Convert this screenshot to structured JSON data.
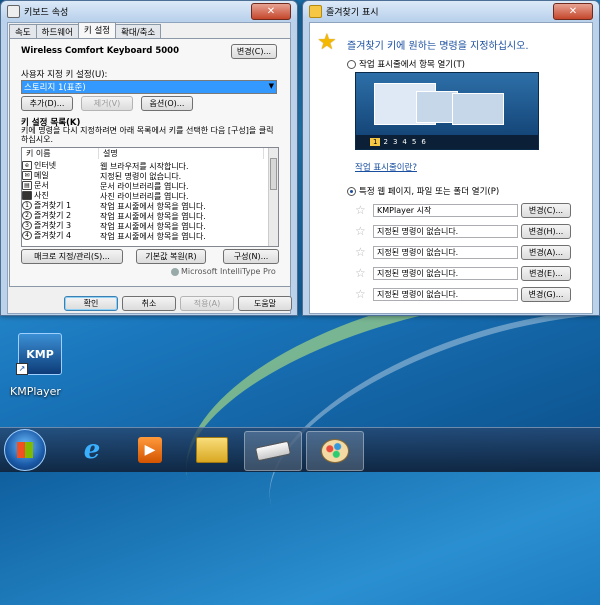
{
  "keyboard_window": {
    "title": "키보드 속성",
    "tabs": [
      "속도",
      "하드웨어",
      "키 설정",
      "확대/축소"
    ],
    "active_tab": "키 설정",
    "device_name": "Wireless Comfort Keyboard 5000",
    "change_button": "변경(C)...",
    "user_settings_label": "사용자 지정 키 설정(U):",
    "user_settings_value": "스토리지 1(표준)",
    "add_button": "추가(D)...",
    "remove_button": "제거(V)",
    "options_button": "옵션(O)...",
    "list_title": "키 설정 목록(K)",
    "list_desc": "키에 명령을 다시 지정하려면 아래 목록에서 키를 선택한 다음 [구성]을 클릭하십시오.",
    "columns": [
      "키 이름",
      "설명"
    ],
    "rows": [
      {
        "icon": "internet-icon",
        "name": "인터넷",
        "desc": "웹 브라우저를 시작합니다."
      },
      {
        "icon": "mail-icon",
        "name": "메일",
        "desc": "지정된 명령이 없습니다."
      },
      {
        "icon": "document-icon",
        "name": "문서",
        "desc": "문서 라이브러리를 엽니다."
      },
      {
        "icon": "photo-icon",
        "name": "사진",
        "desc": "사진 라이브러리를 엽니다."
      },
      {
        "icon": "favorite-1-icon",
        "name": "즐겨찾기 1",
        "desc": "작업 표시줄에서 항목을 엽니다."
      },
      {
        "icon": "favorite-2-icon",
        "name": "즐겨찾기 2",
        "desc": "작업 표시줄에서 항목을 엽니다."
      },
      {
        "icon": "favorite-3-icon",
        "name": "즐겨찾기 3",
        "desc": "작업 표시줄에서 항목을 엽니다."
      },
      {
        "icon": "favorite-4-icon",
        "name": "즐겨찾기 4",
        "desc": "작업 표시줄에서 항목을 엽니다."
      }
    ],
    "macro_button": "매크로 지정/관리(S)...",
    "restore_button": "기본값 복원(R)",
    "configure_button": "구성(N)...",
    "brand": "Microsoft IntelliType Pro",
    "ok_button": "확인",
    "cancel_button": "취소",
    "apply_button": "적용(A)",
    "help_button": "도움말"
  },
  "favorites_window": {
    "title": "즐겨찾기 표시",
    "heading": "즐겨찾기 키에 원하는 명령을 지정하십시오.",
    "option1": "작업 표시줄에서 항목 열기(T)",
    "preview_numbers": [
      "1",
      "2",
      "3",
      "4",
      "5",
      "6"
    ],
    "preview_link": "작업 표시줄이란?",
    "option2": "특정 웹 페이지, 파일 또는 폴더 열기(P)",
    "assignments": [
      {
        "value": "KMPlayer 시작",
        "button": "변경(C)..."
      },
      {
        "value": "지정된 명령이 없습니다.",
        "button": "변경(H)..."
      },
      {
        "value": "지정된 명령이 없습니다.",
        "button": "변경(A)..."
      },
      {
        "value": "지정된 명령이 없습니다.",
        "button": "변경(E)..."
      },
      {
        "value": "지정된 명령이 없습니다.",
        "button": "변경(G)..."
      }
    ]
  },
  "desktop": {
    "icon_label": "KMPlayer",
    "icon_badge": "KMP"
  },
  "taskbar": {
    "items": [
      "start-orb",
      "internet-explorer-icon",
      "media-player-icon",
      "file-explorer-icon",
      "keyboard-icon",
      "paint-icon"
    ]
  },
  "colors": {
    "selection": "#3399ff",
    "accent": "#1b4f9e",
    "link": "#1a4fa0"
  }
}
